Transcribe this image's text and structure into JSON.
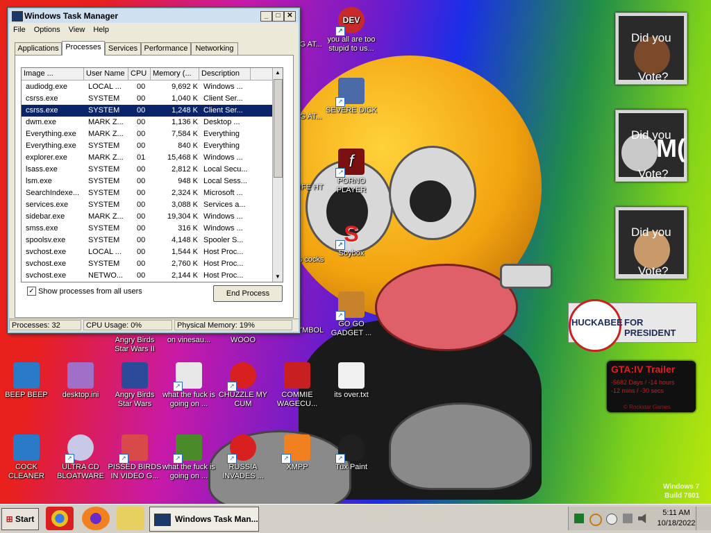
{
  "desktop": {
    "icons": [
      {
        "label": "you all are too stupid to us...",
        "icon": "dev-cpp-icon",
        "color": "#c82a2a"
      },
      {
        "label": "SEVERE DICK",
        "icon": "gear-icon",
        "color": "#4a6aa8"
      },
      {
        "label": "PORNO PLAYER",
        "icon": "flash-icon",
        "color": "#7a1010"
      },
      {
        "label": "Soybox",
        "icon": "s-logo-icon",
        "color": "#e02020"
      },
      {
        "label": "GO GO GADGET ...",
        "icon": "briefcase-icon",
        "color": "#c8822a"
      },
      {
        "label": "BEEP BEEP",
        "icon": "blue-card-icon",
        "color": "#2a7ac8"
      },
      {
        "label": "desktop.ini",
        "icon": "settings-file-icon",
        "color": "#a070c8"
      },
      {
        "label": "Angry Birds Star Wars",
        "icon": "angry-birds-icon",
        "color": "#2a4a9a"
      },
      {
        "label": "what the fuck is going on ...",
        "icon": "angry-birds-icon",
        "color": "#e8e8e8"
      },
      {
        "label": "CHUZZLE MY CUM",
        "icon": "chuzzle-icon",
        "color": "#d82020"
      },
      {
        "label": "COMMIE WAGECU...",
        "icon": "commie-icon",
        "color": "#c82020"
      },
      {
        "label": "its over.txt",
        "icon": "text-file-icon",
        "color": "#f0f0f0"
      },
      {
        "label": "COCK CLEANER",
        "icon": "blue-card-icon",
        "color": "#2a7ac8"
      },
      {
        "label": "ULTRA CD BLOATWARE",
        "icon": "cd-icon",
        "color": "#c8c8e8"
      },
      {
        "label": "PISSED BIRDS IN VIDEO G...",
        "icon": "angry-birds-icon",
        "color": "#d84a4a"
      },
      {
        "label": "what the fuck is going on ...",
        "icon": "angry-birds-pig-icon",
        "color": "#4a8a2a"
      },
      {
        "label": "RUSSIA INVADES ...",
        "icon": "radiation-icon",
        "color": "#d82020"
      },
      {
        "label": "XMPP",
        "icon": "xampp-icon",
        "color": "#f08020"
      },
      {
        "label": "Tux Paint",
        "icon": "penguin-icon",
        "color": "#202020"
      }
    ],
    "partial_labels": [
      "GING AT...",
      "GING AT...",
      "Y WIFE HT",
      "es vs cocks",
      "ISSIA SYMBOL",
      "Angry Birds Star Wars II",
      "on vinesau...",
      "WOOO",
      "BEEP BEEP"
    ],
    "gadgets": {
      "vote_1": {
        "line1": "Did you",
        "line2": "Vote?"
      },
      "vote_2": {
        "line1": "Did you",
        "line2": "Vote?",
        "overlay": "M("
      },
      "vote_3": {
        "line1": "Did you",
        "line2": "Vote?"
      },
      "huckabee": {
        "name": "HUCKABEE",
        "text": "FOR PRESIDENT"
      },
      "gta": {
        "title": "GTA:IV Trailer",
        "line1": "-5682 Days / -14 hours",
        "line2": "-12 mins / -30 secs",
        "footer": "© Rockstar Games"
      }
    },
    "watermark": {
      "line1": "Windows 7",
      "line2": "Build 7601"
    }
  },
  "task_manager": {
    "title": "Windows Task Manager",
    "menu": [
      "File",
      "Options",
      "View",
      "Help"
    ],
    "tabs": [
      "Applications",
      "Processes",
      "Services",
      "Performance",
      "Networking"
    ],
    "active_tab": "Processes",
    "columns": [
      "Image ...",
      "User Name",
      "CPU",
      "Memory (...",
      "Description"
    ],
    "rows": [
      {
        "image": "audiodg.exe",
        "user": "LOCAL ...",
        "cpu": "00",
        "mem": "9,692 K",
        "desc": "Windows ..."
      },
      {
        "image": "csrss.exe",
        "user": "SYSTEM",
        "cpu": "00",
        "mem": "1,040 K",
        "desc": "Client Ser..."
      },
      {
        "image": "csrss.exe",
        "user": "SYSTEM",
        "cpu": "00",
        "mem": "1,248 K",
        "desc": "Client Ser..."
      },
      {
        "image": "dwm.exe",
        "user": "MARK Z...",
        "cpu": "00",
        "mem": "1,136 K",
        "desc": "Desktop ..."
      },
      {
        "image": "Everything.exe",
        "user": "MARK Z...",
        "cpu": "00",
        "mem": "7,584 K",
        "desc": "Everything"
      },
      {
        "image": "Everything.exe",
        "user": "SYSTEM",
        "cpu": "00",
        "mem": "840 K",
        "desc": "Everything"
      },
      {
        "image": "explorer.exe",
        "user": "MARK Z...",
        "cpu": "01",
        "mem": "15,468 K",
        "desc": "Windows ..."
      },
      {
        "image": "lsass.exe",
        "user": "SYSTEM",
        "cpu": "00",
        "mem": "2,812 K",
        "desc": "Local Secu..."
      },
      {
        "image": "lsm.exe",
        "user": "SYSTEM",
        "cpu": "00",
        "mem": "948 K",
        "desc": "Local Sess..."
      },
      {
        "image": "SearchIndexe...",
        "user": "SYSTEM",
        "cpu": "00",
        "mem": "2,324 K",
        "desc": "Microsoft ..."
      },
      {
        "image": "services.exe",
        "user": "SYSTEM",
        "cpu": "00",
        "mem": "3,088 K",
        "desc": "Services a..."
      },
      {
        "image": "sidebar.exe",
        "user": "MARK Z...",
        "cpu": "00",
        "mem": "19,304 K",
        "desc": "Windows ..."
      },
      {
        "image": "smss.exe",
        "user": "SYSTEM",
        "cpu": "00",
        "mem": "316 K",
        "desc": "Windows ..."
      },
      {
        "image": "spoolsv.exe",
        "user": "SYSTEM",
        "cpu": "00",
        "mem": "4,148 K",
        "desc": "Spooler S..."
      },
      {
        "image": "svchost.exe",
        "user": "LOCAL ...",
        "cpu": "00",
        "mem": "1,544 K",
        "desc": "Host Proc..."
      },
      {
        "image": "svchost.exe",
        "user": "SYSTEM",
        "cpu": "00",
        "mem": "2,760 K",
        "desc": "Host Proc..."
      },
      {
        "image": "svchost.exe",
        "user": "NETWO...",
        "cpu": "00",
        "mem": "2,144 K",
        "desc": "Host Proc..."
      }
    ],
    "selected_row": 2,
    "show_all_label": "Show processes from all users",
    "end_process_label": "End Process",
    "status": {
      "processes": "Processes: 32",
      "cpu": "CPU Usage: 0%",
      "memory": "Physical Memory: 19%"
    }
  },
  "taskbar": {
    "start_label": "Start",
    "active_window_label": "Windows Task Man...",
    "clock_time": "5:11 AM",
    "clock_date": "10/18/2022"
  }
}
